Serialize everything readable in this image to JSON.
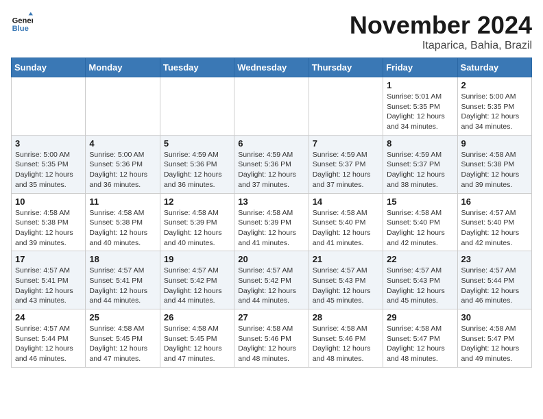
{
  "header": {
    "logo_line1": "General",
    "logo_line2": "Blue",
    "month": "November 2024",
    "location": "Itaparica, Bahia, Brazil"
  },
  "weekdays": [
    "Sunday",
    "Monday",
    "Tuesday",
    "Wednesday",
    "Thursday",
    "Friday",
    "Saturday"
  ],
  "weeks": [
    [
      {
        "day": "",
        "info": ""
      },
      {
        "day": "",
        "info": ""
      },
      {
        "day": "",
        "info": ""
      },
      {
        "day": "",
        "info": ""
      },
      {
        "day": "",
        "info": ""
      },
      {
        "day": "1",
        "info": "Sunrise: 5:01 AM\nSunset: 5:35 PM\nDaylight: 12 hours and 34 minutes."
      },
      {
        "day": "2",
        "info": "Sunrise: 5:00 AM\nSunset: 5:35 PM\nDaylight: 12 hours and 34 minutes."
      }
    ],
    [
      {
        "day": "3",
        "info": "Sunrise: 5:00 AM\nSunset: 5:35 PM\nDaylight: 12 hours and 35 minutes."
      },
      {
        "day": "4",
        "info": "Sunrise: 5:00 AM\nSunset: 5:36 PM\nDaylight: 12 hours and 36 minutes."
      },
      {
        "day": "5",
        "info": "Sunrise: 4:59 AM\nSunset: 5:36 PM\nDaylight: 12 hours and 36 minutes."
      },
      {
        "day": "6",
        "info": "Sunrise: 4:59 AM\nSunset: 5:36 PM\nDaylight: 12 hours and 37 minutes."
      },
      {
        "day": "7",
        "info": "Sunrise: 4:59 AM\nSunset: 5:37 PM\nDaylight: 12 hours and 37 minutes."
      },
      {
        "day": "8",
        "info": "Sunrise: 4:59 AM\nSunset: 5:37 PM\nDaylight: 12 hours and 38 minutes."
      },
      {
        "day": "9",
        "info": "Sunrise: 4:58 AM\nSunset: 5:38 PM\nDaylight: 12 hours and 39 minutes."
      }
    ],
    [
      {
        "day": "10",
        "info": "Sunrise: 4:58 AM\nSunset: 5:38 PM\nDaylight: 12 hours and 39 minutes."
      },
      {
        "day": "11",
        "info": "Sunrise: 4:58 AM\nSunset: 5:38 PM\nDaylight: 12 hours and 40 minutes."
      },
      {
        "day": "12",
        "info": "Sunrise: 4:58 AM\nSunset: 5:39 PM\nDaylight: 12 hours and 40 minutes."
      },
      {
        "day": "13",
        "info": "Sunrise: 4:58 AM\nSunset: 5:39 PM\nDaylight: 12 hours and 41 minutes."
      },
      {
        "day": "14",
        "info": "Sunrise: 4:58 AM\nSunset: 5:40 PM\nDaylight: 12 hours and 41 minutes."
      },
      {
        "day": "15",
        "info": "Sunrise: 4:58 AM\nSunset: 5:40 PM\nDaylight: 12 hours and 42 minutes."
      },
      {
        "day": "16",
        "info": "Sunrise: 4:57 AM\nSunset: 5:40 PM\nDaylight: 12 hours and 42 minutes."
      }
    ],
    [
      {
        "day": "17",
        "info": "Sunrise: 4:57 AM\nSunset: 5:41 PM\nDaylight: 12 hours and 43 minutes."
      },
      {
        "day": "18",
        "info": "Sunrise: 4:57 AM\nSunset: 5:41 PM\nDaylight: 12 hours and 44 minutes."
      },
      {
        "day": "19",
        "info": "Sunrise: 4:57 AM\nSunset: 5:42 PM\nDaylight: 12 hours and 44 minutes."
      },
      {
        "day": "20",
        "info": "Sunrise: 4:57 AM\nSunset: 5:42 PM\nDaylight: 12 hours and 44 minutes."
      },
      {
        "day": "21",
        "info": "Sunrise: 4:57 AM\nSunset: 5:43 PM\nDaylight: 12 hours and 45 minutes."
      },
      {
        "day": "22",
        "info": "Sunrise: 4:57 AM\nSunset: 5:43 PM\nDaylight: 12 hours and 45 minutes."
      },
      {
        "day": "23",
        "info": "Sunrise: 4:57 AM\nSunset: 5:44 PM\nDaylight: 12 hours and 46 minutes."
      }
    ],
    [
      {
        "day": "24",
        "info": "Sunrise: 4:57 AM\nSunset: 5:44 PM\nDaylight: 12 hours and 46 minutes."
      },
      {
        "day": "25",
        "info": "Sunrise: 4:58 AM\nSunset: 5:45 PM\nDaylight: 12 hours and 47 minutes."
      },
      {
        "day": "26",
        "info": "Sunrise: 4:58 AM\nSunset: 5:45 PM\nDaylight: 12 hours and 47 minutes."
      },
      {
        "day": "27",
        "info": "Sunrise: 4:58 AM\nSunset: 5:46 PM\nDaylight: 12 hours and 48 minutes."
      },
      {
        "day": "28",
        "info": "Sunrise: 4:58 AM\nSunset: 5:46 PM\nDaylight: 12 hours and 48 minutes."
      },
      {
        "day": "29",
        "info": "Sunrise: 4:58 AM\nSunset: 5:47 PM\nDaylight: 12 hours and 48 minutes."
      },
      {
        "day": "30",
        "info": "Sunrise: 4:58 AM\nSunset: 5:47 PM\nDaylight: 12 hours and 49 minutes."
      }
    ]
  ]
}
